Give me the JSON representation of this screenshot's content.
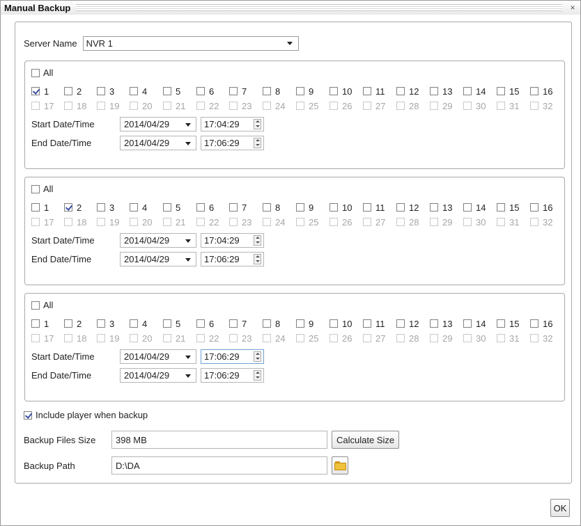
{
  "window": {
    "title": "Manual Backup",
    "close_glyph": "×"
  },
  "server": {
    "label": "Server Name",
    "value": "NVR 1"
  },
  "groups": [
    {
      "all_label": "All",
      "checked_channels": [
        1
      ],
      "start_label": "Start Date/Time",
      "start_date": "2014/04/29",
      "start_time": "17:04:29",
      "end_label": "End Date/Time",
      "end_date": "2014/04/29",
      "end_time": "17:06:29"
    },
    {
      "all_label": "All",
      "checked_channels": [
        2
      ],
      "start_label": "Start Date/Time",
      "start_date": "2014/04/29",
      "start_time": "17:04:29",
      "end_label": "End Date/Time",
      "end_date": "2014/04/29",
      "end_time": "17:06:29"
    },
    {
      "all_label": "All",
      "checked_channels": [],
      "start_label": "Start Date/Time",
      "start_date": "2014/04/29",
      "start_time": "17:06:29",
      "end_label": "End Date/Time",
      "end_date": "2014/04/29",
      "end_time": "17:06:29"
    }
  ],
  "channels_row1": [
    "1",
    "2",
    "3",
    "4",
    "5",
    "6",
    "7",
    "8",
    "9",
    "10",
    "11",
    "12",
    "13",
    "14",
    "15",
    "16"
  ],
  "channels_row2": [
    "17",
    "18",
    "19",
    "20",
    "21",
    "22",
    "23",
    "24",
    "25",
    "26",
    "27",
    "28",
    "29",
    "30",
    "31",
    "32"
  ],
  "include_player": {
    "label": "Include player when backup",
    "checked": true
  },
  "backup_size": {
    "label": "Backup Files Size",
    "value": "398 MB",
    "button": "Calculate Size"
  },
  "backup_path": {
    "label": "Backup Path",
    "value": "D:\\DA"
  },
  "ok_label": "OK",
  "icons": {
    "folder": "folder-icon",
    "spinner": "spinner-icon",
    "dropdown": "chevron-down-icon",
    "close": "close-icon"
  },
  "colors": {
    "check": "#3a4fa3",
    "folder": "#f0c23b",
    "focus": "#6e9fd2"
  }
}
